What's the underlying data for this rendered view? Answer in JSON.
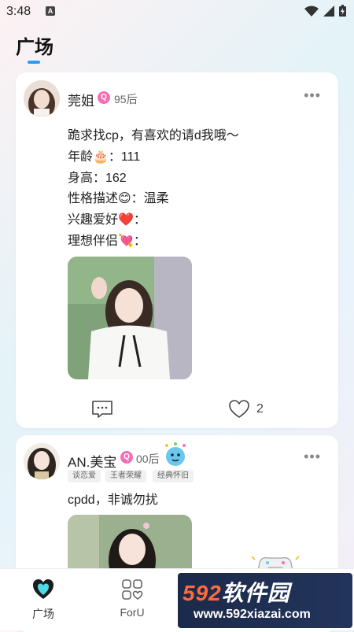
{
  "status": {
    "time": "3:48",
    "notif": "A"
  },
  "header": {
    "title": "广场"
  },
  "posts": [
    {
      "username": "莞姐",
      "badge": "Q",
      "age": "95后",
      "more": "•••",
      "lines": [
        "跪求找cp，有喜欢的请d我哦～",
        "年龄🎂：111",
        "身高：162",
        "性格描述😊：温柔",
        "兴趣爱好❤️：",
        "理想伴侣💘："
      ],
      "likes": "2"
    },
    {
      "username": "AN.美宝",
      "badge": "Q",
      "age": "00后",
      "more": "•••",
      "tags": [
        "谈恋爱",
        "王者荣耀",
        "经典怀旧"
      ],
      "lines": [
        "cpdd，非诚勿扰"
      ]
    }
  ],
  "nav": {
    "items": [
      {
        "label": "广场"
      },
      {
        "label": "ForU"
      }
    ]
  },
  "watermark": {
    "brand_a": "592",
    "brand_b": "软件园",
    "url": "www.592xiazai.com"
  },
  "colors": {
    "accent": "#2f9bff",
    "badge": "#f46fb3",
    "brand": "#3aa0ff"
  }
}
